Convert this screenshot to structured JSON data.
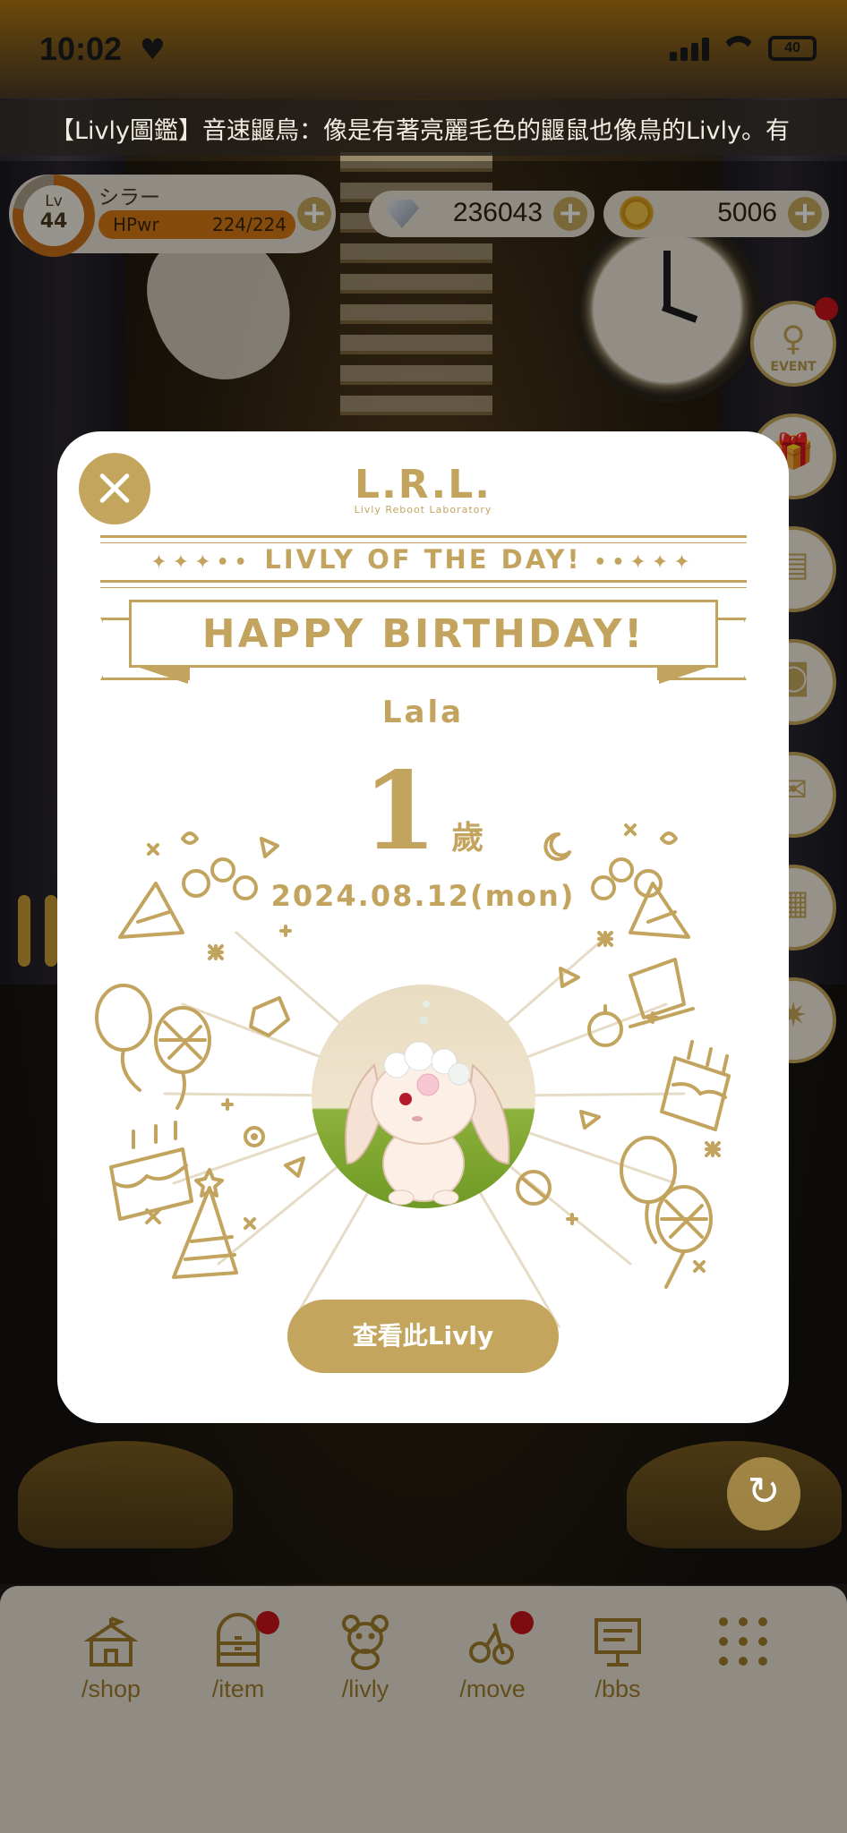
{
  "status_bar": {
    "time": "10:02",
    "battery": "40"
  },
  "ticker": {
    "text": "【Livly圖鑑】音速鼴鳥：像是有著亮麗毛色的鼴鼠也像鳥的Livly。有"
  },
  "player": {
    "level_label": "Lv",
    "level": "44",
    "name": "シラー",
    "hp_label": "HPwr",
    "hp_value": "224/224",
    "level_progress": 0.78
  },
  "currency": {
    "gems": "236043",
    "coins": "5006"
  },
  "side_buttons": {
    "event_label": "EVENT"
  },
  "modal": {
    "logo": "L.R.L.",
    "logo_sub": "Livly Reboot Laboratory",
    "section_title": "LIVLY OF THE DAY!",
    "banner": "HAPPY BIRTHDAY!",
    "livly_name": "Lala",
    "age": "1",
    "age_unit": "歲",
    "date": "2024.08.12(mon)",
    "view_button": "查看此Livly"
  },
  "bottom_nav": [
    {
      "label": "/shop",
      "icon": "shop-tent-icon",
      "badge": false
    },
    {
      "label": "/item",
      "icon": "item-chest-icon",
      "badge": true
    },
    {
      "label": "/livly",
      "icon": "livly-bear-icon",
      "badge": false
    },
    {
      "label": "/move",
      "icon": "move-icon",
      "badge": true
    },
    {
      "label": "/bbs",
      "icon": "bbs-board-icon",
      "badge": false
    },
    {
      "label": "",
      "icon": "menu-grid-icon",
      "badge": false
    }
  ],
  "colors": {
    "gold": "#c2a45e",
    "badge_red": "#c8141b",
    "hp_orange": "#d57a14"
  }
}
